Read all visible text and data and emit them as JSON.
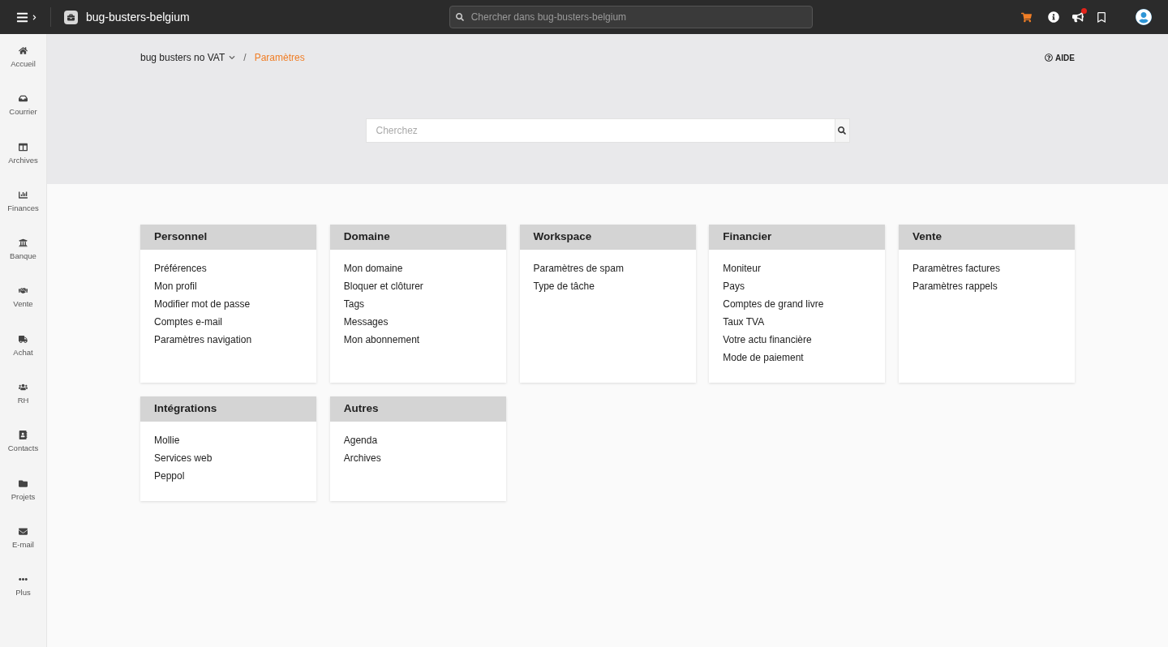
{
  "topbar": {
    "workspace": "bug-busters-belgium",
    "search_placeholder": "Chercher dans bug-busters-belgium",
    "notification": true
  },
  "sidebar": {
    "items": [
      {
        "kind": "home",
        "label": "Accueil"
      },
      {
        "kind": "inbox",
        "label": "Courrier"
      },
      {
        "kind": "archive",
        "label": "Archives"
      },
      {
        "kind": "chart",
        "label": "Finances"
      },
      {
        "kind": "bank",
        "label": "Banque"
      },
      {
        "kind": "handshake",
        "label": "Vente"
      },
      {
        "kind": "truck",
        "label": "Achat"
      },
      {
        "kind": "users",
        "label": "RH"
      },
      {
        "kind": "contacts",
        "label": "Contacts"
      },
      {
        "kind": "folder",
        "label": "Projets"
      },
      {
        "kind": "mail",
        "label": "E-mail"
      },
      {
        "kind": "more",
        "label": "Plus"
      }
    ]
  },
  "breadcrumb": {
    "company": "bug busters no VAT",
    "separator": "/",
    "current": "Paramètres"
  },
  "help": "AIDE",
  "search": {
    "placeholder": "Cherchez"
  },
  "sections": [
    {
      "title": "Personnel",
      "items": [
        "Préférences",
        "Mon profil",
        "Modifier mot de passe",
        "Comptes e-mail",
        "Paramètres navigation"
      ]
    },
    {
      "title": "Domaine",
      "items": [
        "Mon domaine",
        "Bloquer et clôturer",
        "Tags",
        "Messages",
        "Mon abonnement"
      ]
    },
    {
      "title": "Workspace",
      "items": [
        "Paramètres de spam",
        "Type de tâche"
      ]
    },
    {
      "title": "Financier",
      "items": [
        "Moniteur",
        "Pays",
        "Comptes de grand livre",
        "Taux TVA",
        "Votre actu financière",
        "Mode de paiement"
      ]
    },
    {
      "title": "Vente",
      "items": [
        "Paramètres factures",
        "Paramètres rappels"
      ]
    },
    {
      "title": "Intégrations",
      "items": [
        "Mollie",
        "Services web",
        "Peppol"
      ]
    },
    {
      "title": "Autres",
      "items": [
        "Agenda",
        "Archives"
      ]
    }
  ]
}
